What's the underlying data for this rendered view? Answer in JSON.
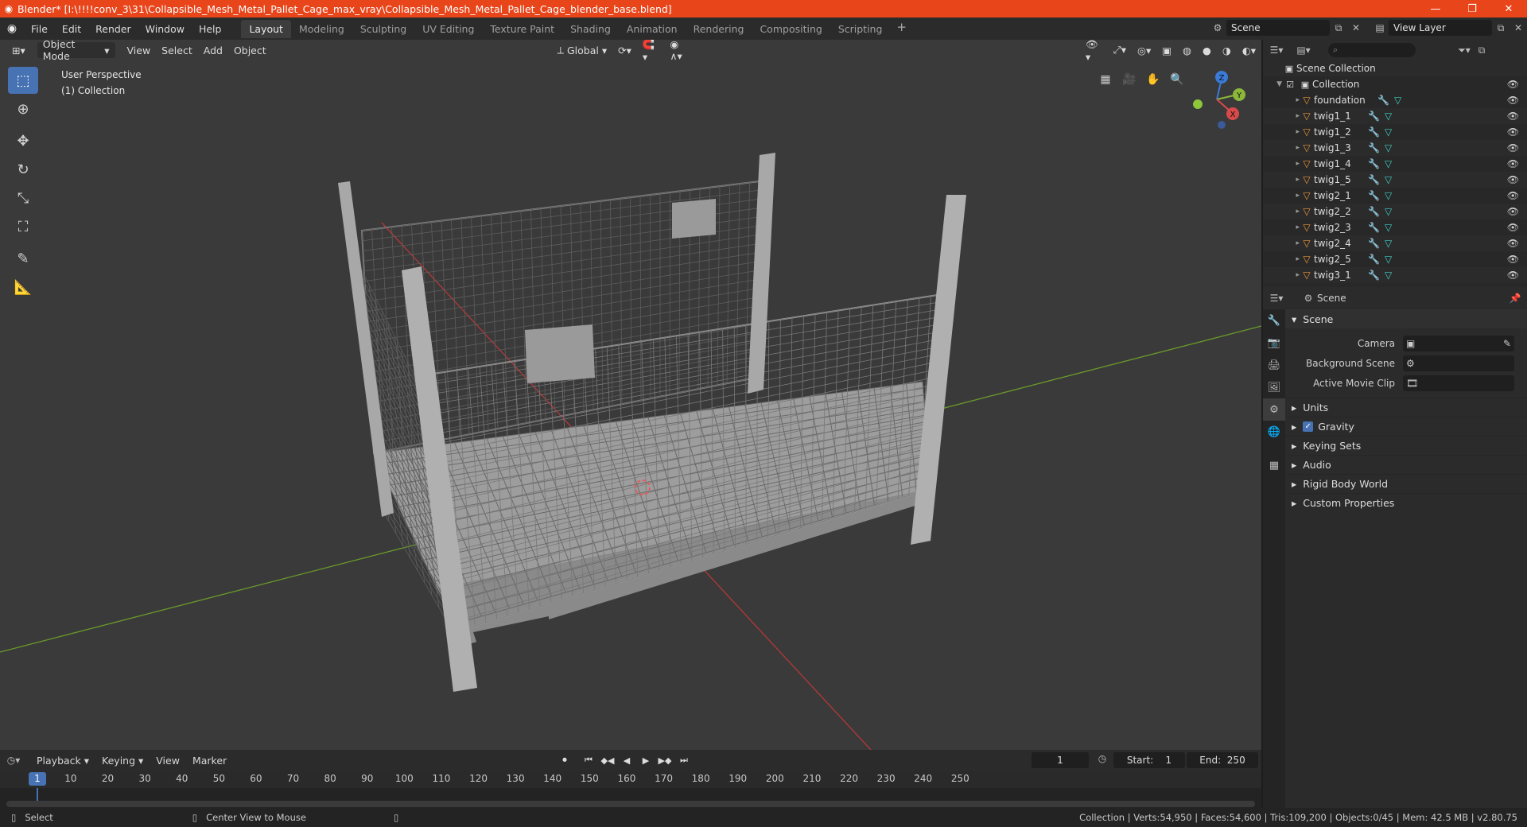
{
  "window": {
    "title": "Blender* [I:\\!!!!conv_3\\31\\Collapsible_Mesh_Metal_Pallet_Cage_max_vray\\Collapsible_Mesh_Metal_Pallet_Cage_blender_base.blend]",
    "controls": [
      "—",
      "❐",
      "✕"
    ]
  },
  "menu": [
    "File",
    "Edit",
    "Render",
    "Window",
    "Help"
  ],
  "workspaces": [
    "Layout",
    "Modeling",
    "Sculpting",
    "UV Editing",
    "Texture Paint",
    "Shading",
    "Animation",
    "Rendering",
    "Compositing",
    "Scripting"
  ],
  "active_workspace": "Layout",
  "scene_name": "Scene",
  "view_layer": "View Layer",
  "viewport": {
    "mode": "Object Mode",
    "menus": [
      "View",
      "Select",
      "Add",
      "Object"
    ],
    "orientation": "Global",
    "perspective": "User Perspective",
    "collection": "(1) Collection",
    "axes": {
      "x": "X",
      "y": "Y",
      "z": "Z"
    }
  },
  "outliner": {
    "root": "Scene Collection",
    "collection": "Collection",
    "objects": [
      "foundation",
      "twig1_1",
      "twig1_2",
      "twig1_3",
      "twig1_4",
      "twig1_5",
      "twig2_1",
      "twig2_2",
      "twig2_3",
      "twig2_4",
      "twig2_5",
      "twig3_1"
    ]
  },
  "properties": {
    "header": "Scene",
    "panel": "Scene",
    "fields": [
      {
        "label": "Camera",
        "value": ""
      },
      {
        "label": "Background Scene",
        "value": ""
      },
      {
        "label": "Active Movie Clip",
        "value": ""
      }
    ],
    "subpanels": [
      "Units",
      "Gravity",
      "Keying Sets",
      "Audio",
      "Rigid Body World",
      "Custom Properties"
    ]
  },
  "timeline": {
    "menus": [
      "Playback",
      "Keying",
      "View",
      "Marker"
    ],
    "current_frame": "1",
    "start_label": "Start:",
    "start": "1",
    "end_label": "End:",
    "end": "250",
    "ticks": [
      "1",
      "10",
      "20",
      "30",
      "40",
      "50",
      "60",
      "70",
      "80",
      "90",
      "100",
      "110",
      "120",
      "130",
      "140",
      "150",
      "160",
      "170",
      "180",
      "190",
      "200",
      "210",
      "220",
      "230",
      "240",
      "250"
    ]
  },
  "status": {
    "select": "Select",
    "center": "Center View to Mouse",
    "stats": "Collection | Verts:54,950 | Faces:54,600 | Tris:109,200 | Objects:0/45 | Mem: 42.5 MB | v2.80.75"
  }
}
